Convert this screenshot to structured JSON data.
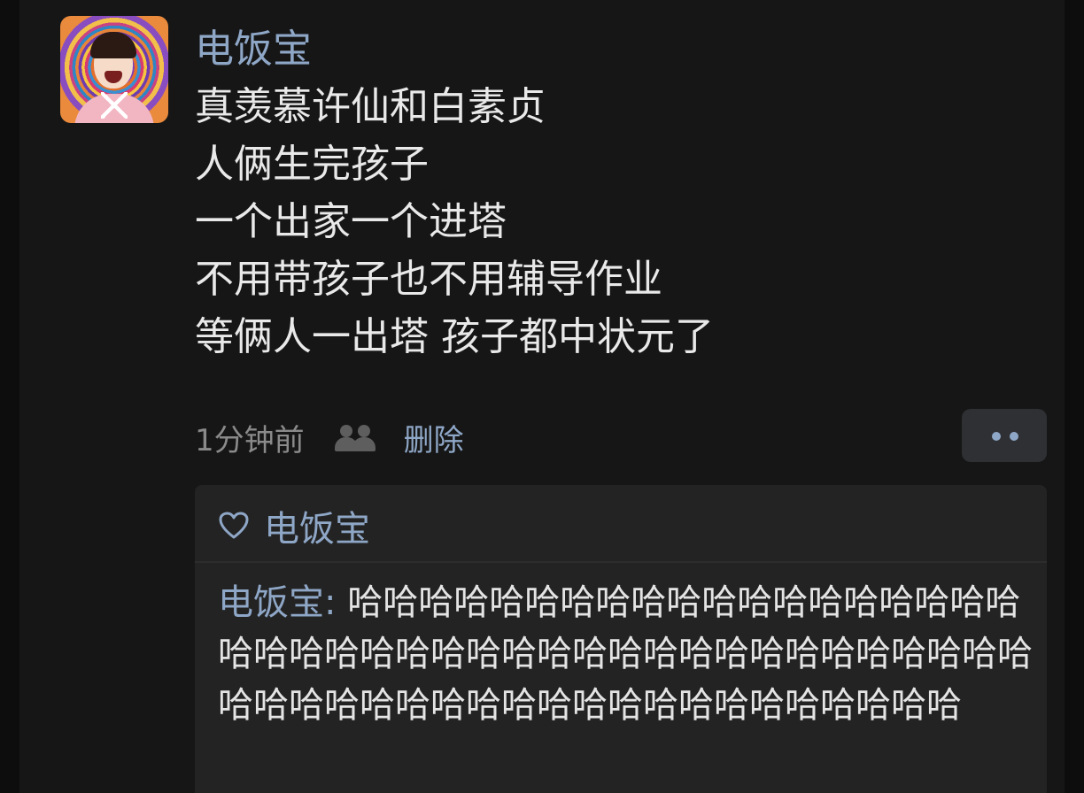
{
  "post": {
    "author": "电饭宝",
    "lines": [
      "真羡慕许仙和白素贞",
      "人俩生完孩子",
      "一个出家一个进塔",
      "不用带孩子也不用辅导作业",
      "等俩人一出塔 孩子都中状元了"
    ],
    "time": "1分钟前",
    "delete_label": "删除"
  },
  "likes": {
    "names": "电饭宝"
  },
  "comment": {
    "author": "电饭宝",
    "separator": ": ",
    "text": "哈哈哈哈哈哈哈哈哈哈哈哈哈哈哈哈哈哈哈哈哈哈哈哈哈哈哈哈哈哈哈哈哈哈哈哈哈哈哈哈哈哈哈哈哈哈哈哈哈哈哈哈哈哈哈哈哈哈哈哈哈哈哈"
  },
  "colors": {
    "background": "#0d0d0d",
    "card": "#232323",
    "link": "#8fa7c7",
    "text": "#e9e9e9",
    "muted": "#8a8a8a"
  },
  "icons": {
    "people": "people-icon",
    "heart": "heart-icon",
    "more": "more-icon"
  }
}
